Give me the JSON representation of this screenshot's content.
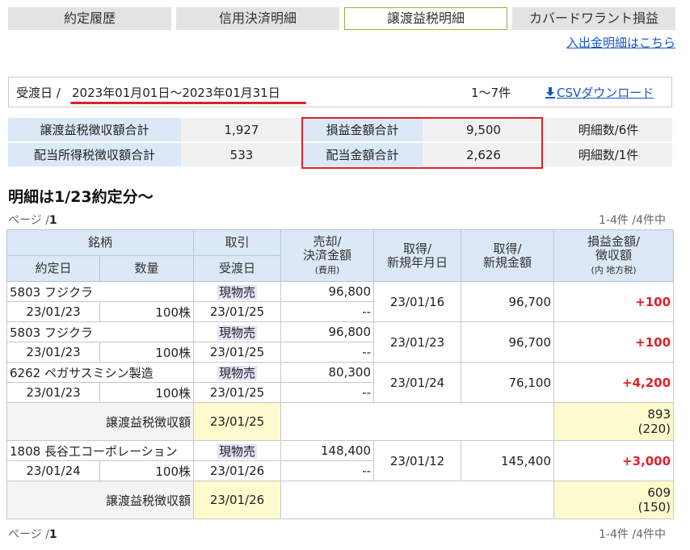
{
  "tabs": [
    {
      "label": "約定履歴"
    },
    {
      "label": "信用決済明細"
    },
    {
      "label": "譲渡益税明細"
    },
    {
      "label": "カバードワラント損益"
    }
  ],
  "active_tab": "譲渡益税明細",
  "deposit_link": "入出金明細はこちら",
  "date_bar": {
    "label": "受渡日",
    "separator": "/",
    "range": "2023年01月01日～2023年01月31日",
    "count": "1～7件",
    "csv": "CSVダウンロード"
  },
  "summary": {
    "row1": {
      "h1": "譲渡益税徴収額合計",
      "v1": "1,927",
      "h2": "損益金額合計",
      "v2": "9,500",
      "note": "明細数/6件"
    },
    "row2": {
      "h1": "配当所得税徴収額合計",
      "v1": "533",
      "h2": "配当金額合計",
      "v2": "2,626",
      "note": "明細数/1件"
    }
  },
  "subhead": "明細は1/23約定分～",
  "pager": {
    "label": "ページ",
    "sep": "/",
    "page": "1",
    "range": "1-4件 /4件中"
  },
  "headers": {
    "meigara": "銘柄",
    "yakujo": "約定日",
    "suryo": "数量",
    "torihiki": "取引",
    "ukewatashi": "受渡日",
    "baikyaku_1": "売却/",
    "baikyaku_2": "決済金額",
    "baikyaku_3": "(費用)",
    "shutoku_date_1": "取得/",
    "shutoku_date_2": "新規年月日",
    "shutoku_amt_1": "取得/",
    "shutoku_amt_2": "新規金額",
    "pl_1": "損益金額/",
    "pl_2": "徴収額",
    "pl_3": "(内 地方税)"
  },
  "trades": [
    {
      "name": "5803 フジクラ",
      "trade_date": "23/01/23",
      "qty": "100株",
      "kind": "現物売",
      "settle": "23/01/25",
      "amount": "96,800",
      "cost": "--",
      "acq_date": "23/01/16",
      "acq_amount": "96,700",
      "pl": "+100"
    },
    {
      "name": "5803 フジクラ",
      "trade_date": "23/01/23",
      "qty": "100株",
      "kind": "現物売",
      "settle": "23/01/25",
      "amount": "96,800",
      "cost": "--",
      "acq_date": "23/01/23",
      "acq_amount": "96,700",
      "pl": "+100"
    },
    {
      "name": "6262 ペガサスミシン製造",
      "trade_date": "23/01/23",
      "qty": "100株",
      "kind": "現物売",
      "settle": "23/01/25",
      "amount": "80,300",
      "cost": "--",
      "acq_date": "23/01/24",
      "acq_amount": "76,100",
      "pl": "+4,200"
    },
    {
      "name": "1808 長谷工コーポレーション",
      "trade_date": "23/01/24",
      "qty": "100株",
      "kind": "現物売",
      "settle": "23/01/26",
      "amount": "148,400",
      "cost": "--",
      "acq_date": "23/01/12",
      "acq_amount": "145,400",
      "pl": "+3,000"
    }
  ],
  "tax_rows": [
    {
      "label": "譲渡益税徴収額",
      "date": "23/01/25",
      "tax": "893",
      "local": "(220)"
    },
    {
      "label": "譲渡益税徴収額",
      "date": "23/01/26",
      "tax": "609",
      "local": "(150)"
    }
  ],
  "colors": {
    "accent_blue": "#dbe8f5",
    "highlight_red": "#e0202a",
    "tab_active_border": "#8bb940",
    "link": "#1a56c8",
    "tax_yellow": "#fdfbce"
  }
}
